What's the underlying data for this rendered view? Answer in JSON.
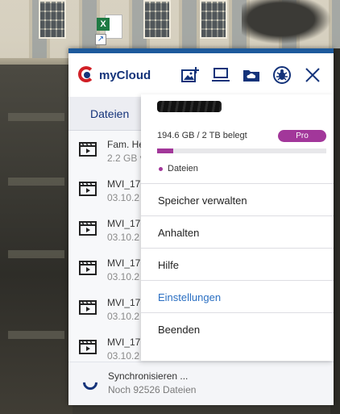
{
  "desktop": {
    "shortcut_badge": "X"
  },
  "app": {
    "brand": "mycloud",
    "brand_display": "myCloud",
    "colors": {
      "primary": "#14337a",
      "accent": "#a2379a",
      "logo_red": "#d11f26",
      "link": "#2a6fc2"
    },
    "header_icons": [
      "add-photo-icon",
      "computer-icon",
      "cloud-folder-icon",
      "bug-icon",
      "close-icon"
    ],
    "tab_label": "Dateien",
    "files": [
      {
        "name": "Fam. He",
        "meta": "2.2 GB v"
      },
      {
        "name": "MVI_17",
        "meta": "03.10.2"
      },
      {
        "name": "MVI_17",
        "meta": "03.10.2"
      },
      {
        "name": "MVI_17",
        "meta": "03.10.2"
      },
      {
        "name": "MVI_17",
        "meta": "03.10.2"
      },
      {
        "name": "MVI_17",
        "meta": "03.10.2"
      }
    ],
    "sync": {
      "title": "Synchronisieren ...",
      "subtitle": "Noch 92526 Dateien"
    }
  },
  "menu": {
    "storage_text": "194.6 GB / 2 TB belegt",
    "plan_badge": "Pro",
    "storage_fraction": 0.0973,
    "legend_label": "Dateien",
    "items": [
      "Speicher verwalten",
      "Anhalten",
      "Hilfe",
      "Einstellungen",
      "Beenden"
    ]
  }
}
